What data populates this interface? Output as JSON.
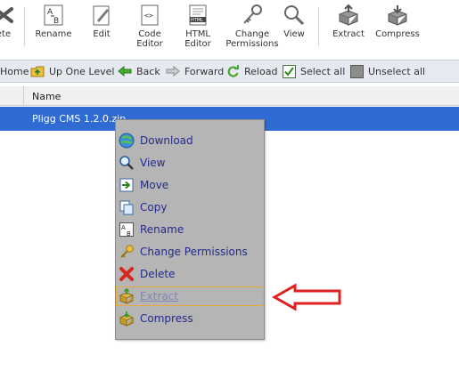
{
  "toolbar": {
    "buttons": [
      {
        "label": "ete",
        "icon": "delete-icon"
      },
      {
        "label": "Rename",
        "icon": "rename-icon"
      },
      {
        "label": "Edit",
        "icon": "edit-icon"
      },
      {
        "label": "Code\nEditor",
        "icon": "code-editor-icon"
      },
      {
        "label": "HTML\nEditor",
        "icon": "html-editor-icon"
      },
      {
        "label": "Change\nPermissions",
        "icon": "permissions-icon"
      },
      {
        "label": "View",
        "icon": "view-icon"
      },
      {
        "label": "Extract",
        "icon": "extract-icon"
      },
      {
        "label": "Compress",
        "icon": "compress-icon"
      }
    ]
  },
  "navbar": {
    "home": "Home",
    "up_one_level": "Up One Level",
    "back": "Back",
    "forward": "Forward",
    "reload": "Reload",
    "select_all": "Select all",
    "unselect_all": "Unselect all"
  },
  "table": {
    "columns": [
      "Name"
    ],
    "rows": [
      {
        "name": "Pligg CMS 1.2.0.zip",
        "selected": true
      }
    ]
  },
  "context_menu": {
    "items": [
      {
        "label": "Download",
        "icon": "download-icon",
        "enabled": true
      },
      {
        "label": "View",
        "icon": "view-icon",
        "enabled": true
      },
      {
        "label": "Move",
        "icon": "move-icon",
        "enabled": true
      },
      {
        "label": "Copy",
        "icon": "copy-icon",
        "enabled": true
      },
      {
        "label": "Rename",
        "icon": "rename-icon",
        "enabled": true
      },
      {
        "label": "Change Permissions",
        "icon": "permissions-icon",
        "enabled": true
      },
      {
        "label": "Delete",
        "icon": "delete-icon",
        "enabled": true
      },
      {
        "label": "Extract",
        "icon": "extract-icon",
        "enabled": false,
        "highlighted": true
      },
      {
        "label": "Compress",
        "icon": "compress-icon",
        "enabled": true
      }
    ]
  },
  "colors": {
    "selection": "#2f6bd3",
    "menu_bg": "#b5b5b5",
    "menu_text": "#252a8c",
    "annotation": "#e02020"
  }
}
